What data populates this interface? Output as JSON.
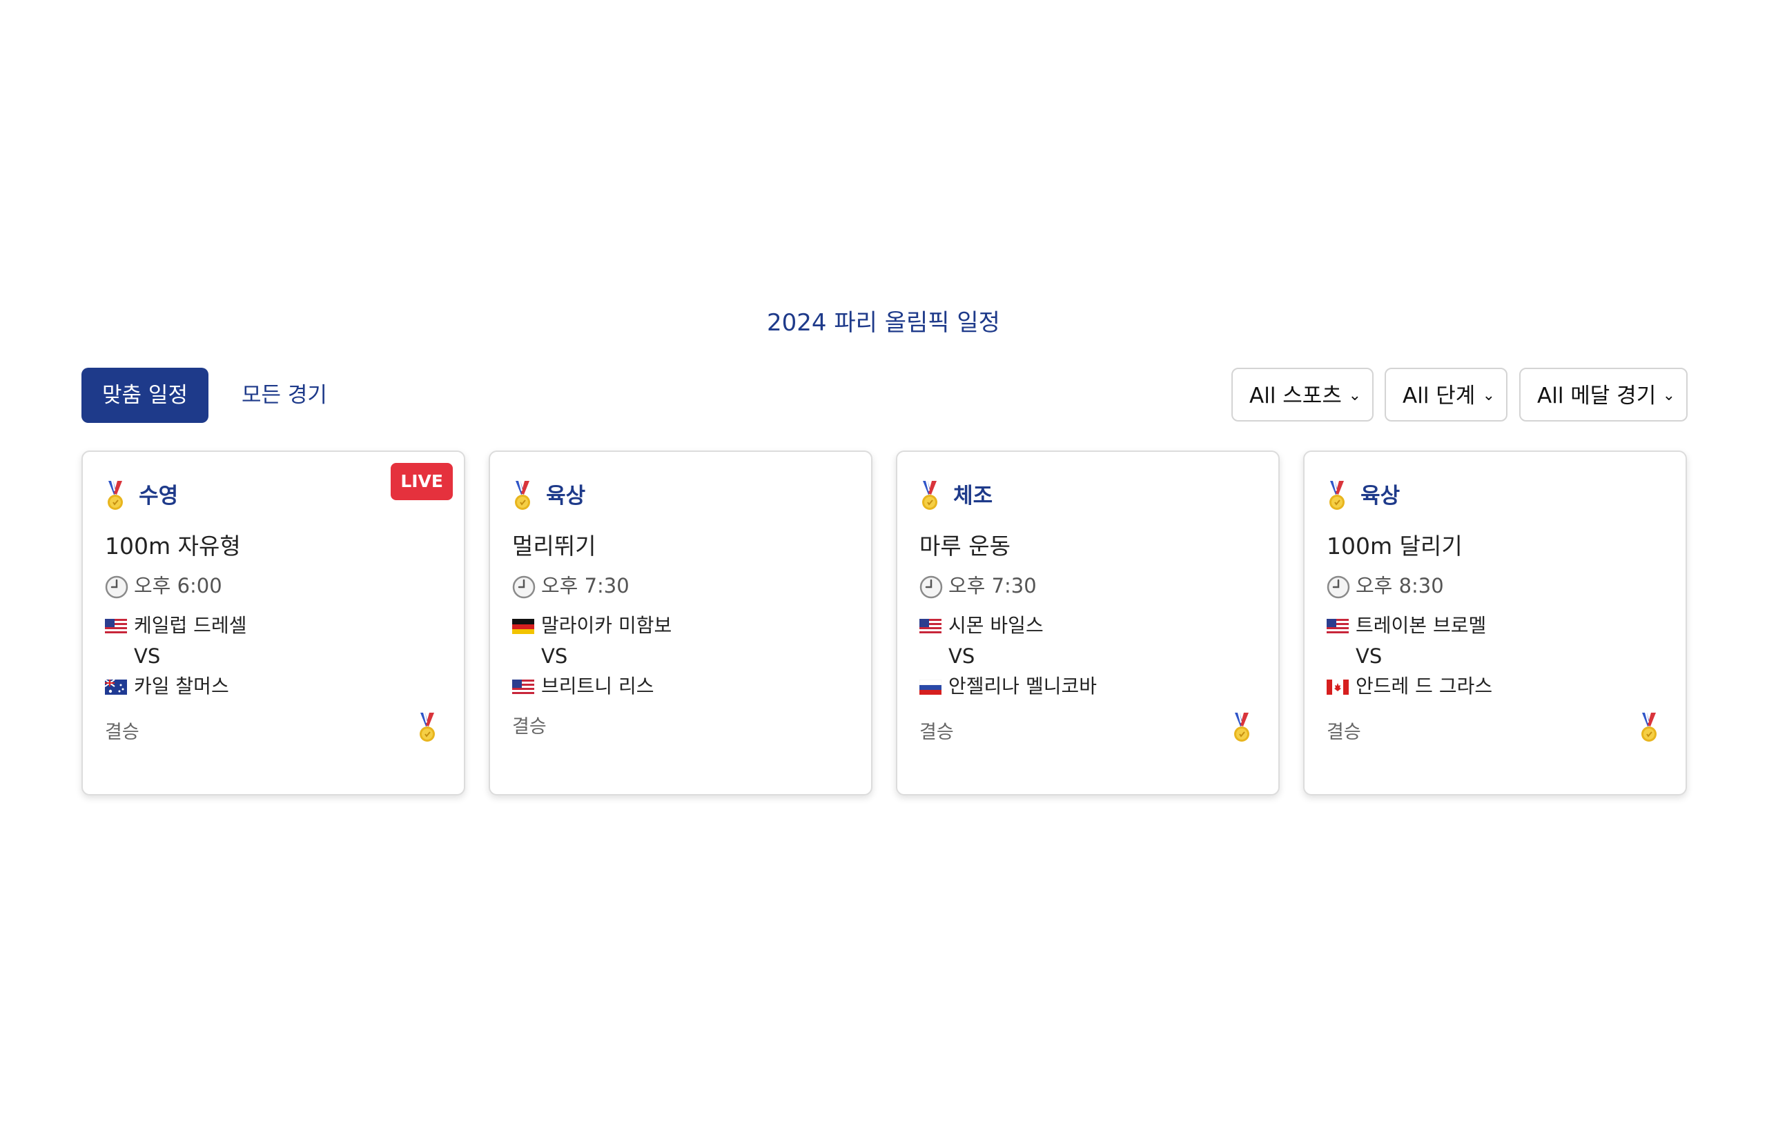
{
  "page": {
    "title": "2024 파리 올림픽 일정"
  },
  "tabs": [
    {
      "label": "맞춤 일정",
      "active": true
    },
    {
      "label": "모든 경기",
      "active": false
    }
  ],
  "filters": {
    "sport": "All 스포츠",
    "stage": "All 단계",
    "medal": "All 메달 경기"
  },
  "colors": {
    "primary": "#1e3a8a",
    "live": "#e5313d"
  },
  "cards": [
    {
      "sport": "수영",
      "live": true,
      "live_label": "LIVE",
      "event": "100m 자유형",
      "time": "오후 6:00",
      "athlete1": {
        "name": "케일럽 드레셀",
        "flag": "us-flag"
      },
      "vs": "VS",
      "athlete2": {
        "name": "카일 찰머스",
        "flag": "au-flag"
      },
      "stage": "결승",
      "medal_event": true
    },
    {
      "sport": "육상",
      "live": false,
      "event": "멀리뛰기",
      "time": "오후 7:30",
      "athlete1": {
        "name": "말라이카 미함보",
        "flag": "de-flag"
      },
      "vs": "VS",
      "athlete2": {
        "name": "브리트니 리스",
        "flag": "us-flag"
      },
      "stage": "결승",
      "medal_event": false
    },
    {
      "sport": "체조",
      "live": false,
      "event": "마루 운동",
      "time": "오후 7:30",
      "athlete1": {
        "name": "시몬 바일스",
        "flag": "us-flag"
      },
      "vs": "VS",
      "athlete2": {
        "name": "안젤리나 멜니코바",
        "flag": "ru-flag"
      },
      "stage": "결승",
      "medal_event": true
    },
    {
      "sport": "육상",
      "live": false,
      "event": "100m 달리기",
      "time": "오후 8:30",
      "athlete1": {
        "name": "트레이본 브로멜",
        "flag": "us-flag"
      },
      "vs": "VS",
      "athlete2": {
        "name": "안드레 드 그라스",
        "flag": "ca-flag"
      },
      "stage": "결승",
      "medal_event": true
    }
  ]
}
